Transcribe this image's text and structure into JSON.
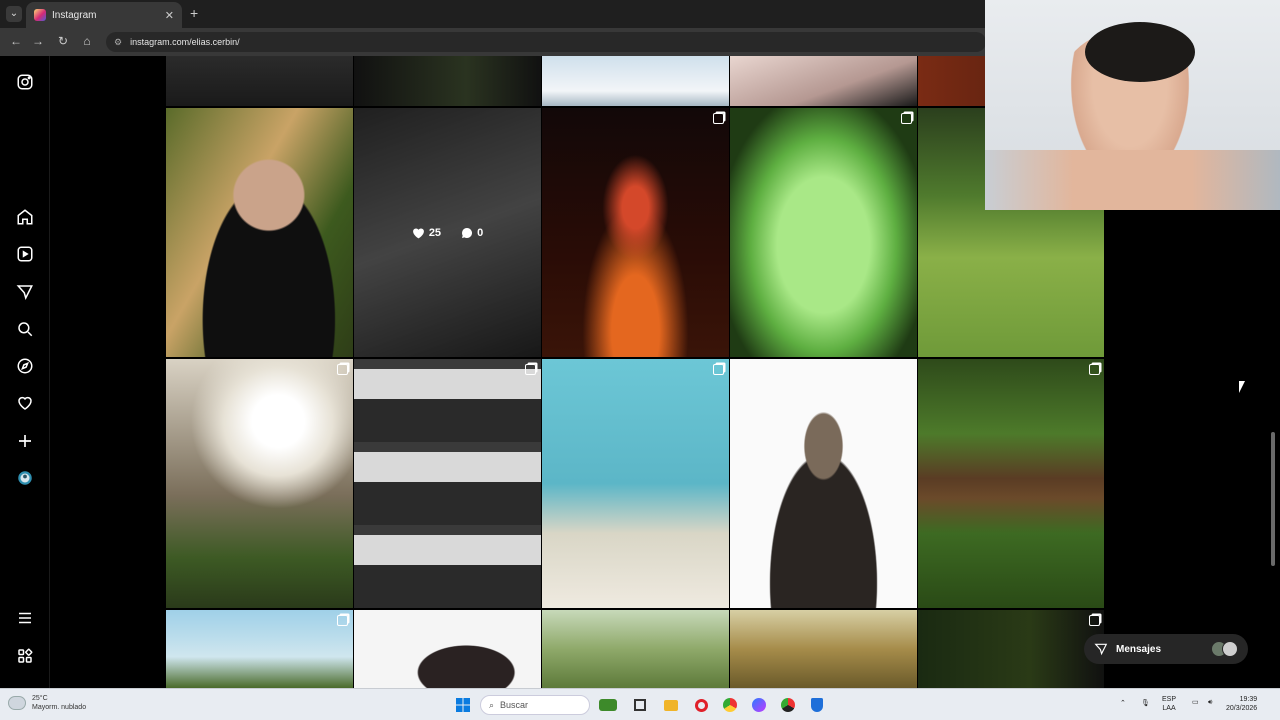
{
  "browser": {
    "tab_title": "Instagram",
    "url": "instagram.com/elias.cerbin/"
  },
  "post_overlay": {
    "likes": "25",
    "comments": "0"
  },
  "messages_button": {
    "label": "Mensajes"
  },
  "taskbar": {
    "weather_temp": "25°C",
    "weather_desc": "Mayorm. nublado",
    "search_placeholder": "Buscar",
    "lang_line1": "ESP",
    "lang_line2": "LAA",
    "time": "19:39",
    "date": "20/3/2026"
  },
  "colors": {
    "accent": "#0095f6",
    "sidebar_bg": "#000000",
    "taskbar_bg": "#e8ecf2"
  }
}
